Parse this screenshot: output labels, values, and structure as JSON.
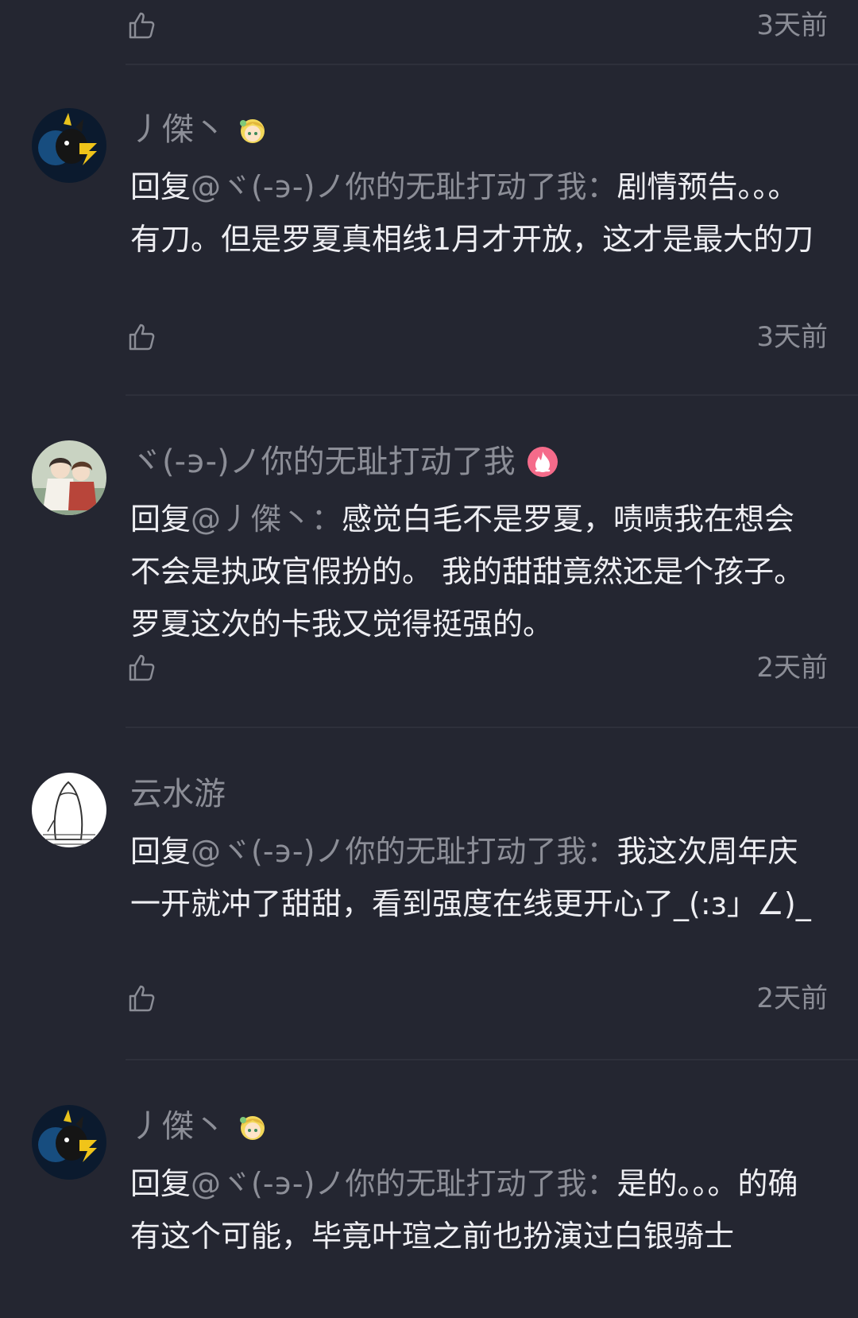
{
  "top": {
    "time": "3天前"
  },
  "comments": [
    {
      "name": "丿傑丶",
      "reply_prefix": "回复",
      "mention": "@ヾ(-϶-)ノ你的无耻打动了我：",
      "text": "剧情预告。。。有刀。但是罗夏真相线1月才开放，这才是最大的刀",
      "time": "3天前",
      "avatar_icon": "pikachu-avatar",
      "badge_icon": "anime-girl-badge"
    },
    {
      "name": "ヾ(-϶-)ノ你的无耻打动了我",
      "reply_prefix": "回复",
      "mention": "@丿傑丶：",
      "text": "感觉白毛不是罗夏，啧啧我在想会不会是执政官假扮的。 我的甜甜竟然还是个孩子。罗夏这次的卡我又觉得挺强的。",
      "time": "2天前",
      "avatar_icon": "anime-couple-avatar",
      "badge_icon": "flame-badge"
    },
    {
      "name": "云水游",
      "reply_prefix": "回复",
      "mention": "@ヾ(-϶-)ノ你的无耻打动了我：",
      "text": "我这次周年庆一开就冲了甜甜，看到强度在线更开心了_(:з」∠)_",
      "time": "2天前",
      "avatar_icon": "white-sketch-avatar",
      "badge_icon": ""
    },
    {
      "name": "丿傑丶",
      "reply_prefix": "回复",
      "mention": "@ヾ(-϶-)ノ你的无耻打动了我：",
      "text": "是的。。。的确有这个可能，毕竟叶瑄之前也扮演过白银骑士",
      "time": "",
      "avatar_icon": "pikachu-avatar",
      "badge_icon": "anime-girl-badge"
    }
  ],
  "colors": {
    "background": "#242631",
    "name": "#8c8e97",
    "text": "#eeeef2",
    "time": "#8b8d96",
    "divider": "#2e303b",
    "flame_badge": "#f56b8a"
  }
}
